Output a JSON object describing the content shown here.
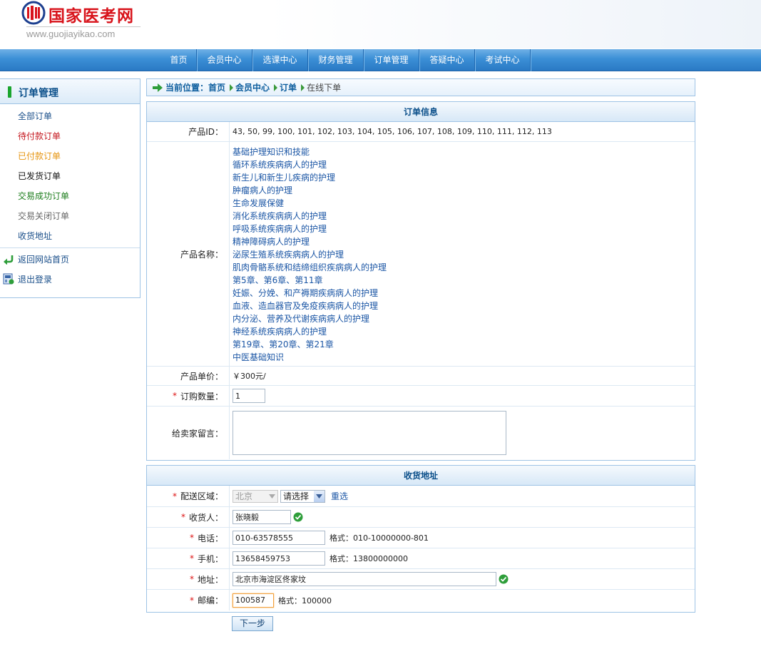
{
  "logo": {
    "text": "国家医考网",
    "url": "www.guojiayikao.com",
    "brand_color": "#d8131b"
  },
  "nav": {
    "items": [
      "首页",
      "会员中心",
      "选课中心",
      "财务管理",
      "订单管理",
      "答疑中心",
      "考试中心"
    ]
  },
  "sidebar": {
    "title": "订单管理",
    "links": [
      {
        "label": "全部订单",
        "color": "#1a4f8a"
      },
      {
        "label": "待付款订单",
        "color": "#c4151c"
      },
      {
        "label": "已付款订单",
        "color": "#e6940f"
      },
      {
        "label": "已发货订单",
        "color": "#111111"
      },
      {
        "label": "交易成功订单",
        "color": "#1c7d1c"
      },
      {
        "label": "交易关闭订单",
        "color": "#666666"
      },
      {
        "label": "收货地址",
        "color": "#1a4f8a"
      }
    ],
    "home_link": {
      "label": "返回网站首页",
      "icon": "return-arrow-icon"
    },
    "logout_link": {
      "label": "退出登录",
      "icon": "logout-icon"
    }
  },
  "breadcrumb": {
    "prefix": "当前位置：",
    "items": [
      "首页",
      "会员中心",
      "订单"
    ],
    "current": "在线下单"
  },
  "order": {
    "title": "订单信息",
    "product_id_label": "产品ID：",
    "product_id_value": "43, 50, 99, 100, 101, 102, 103, 104, 105, 106, 107, 108, 109, 110, 111, 112, 113",
    "product_name_label": "产品名称：",
    "product_names": [
      "基础护理知识和技能",
      "循环系统疾病病人的护理",
      "新生儿和新生儿疾病的护理",
      "肿瘤病人的护理",
      "生命发展保健",
      "消化系统疾病病人的护理",
      "呼吸系统疾病病人的护理",
      "精神障碍病人的护理",
      "泌尿生殖系统疾病病人的护理",
      "肌肉骨骼系统和结缔组织疾病病人的护理",
      "第5章、第6章、第11章",
      "妊娠、分娩、和产褥期疾病病人的护理",
      "血液、造血器官及免疫疾病病人的护理",
      "内分泌、营养及代谢疾病病人的护理",
      "神经系统疾病病人的护理",
      "第19章、第20章、第21章",
      "中医基础知识"
    ],
    "price_label": "产品单价：",
    "price_value": "￥300元/",
    "required_mark": "*",
    "quantity_label": "订购数量：",
    "quantity_value": "1",
    "message_label": "给卖家留言：",
    "message_value": ""
  },
  "address": {
    "title": "收货地址",
    "region_label": "配送区域：",
    "region_province": "北京",
    "region_city": "请选择",
    "reselect_label": "重选",
    "receiver_label": "收货人：",
    "receiver_value": "张晓毅",
    "phone_label": "电话：",
    "phone_value": "010-63578555",
    "phone_hint": "格式：010-10000000-801",
    "mobile_label": "手机：",
    "mobile_value": "13658459753",
    "mobile_hint": "格式：13800000000",
    "addr_label": "地址：",
    "addr_value": "北京市海淀区佟家坟",
    "zip_label": "邮编：",
    "zip_value": "100587",
    "zip_hint": "格式：100000"
  },
  "next_button": "下一步",
  "colors": {
    "accent": "#2a79c4",
    "panel_border": "#9ec3e5",
    "ok_green": "#2e9e3a"
  }
}
